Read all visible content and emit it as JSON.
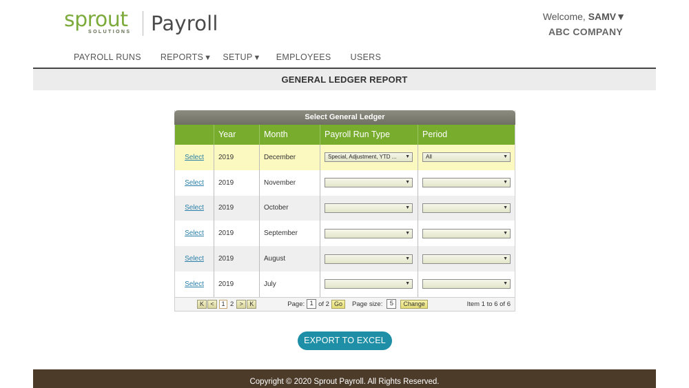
{
  "header": {
    "logo_word": "sprout",
    "logo_sub": "SOLUTIONS",
    "product": "Payroll",
    "welcome_prefix": "Welcome, ",
    "user": "SAMV",
    "company": "ABC COMPANY"
  },
  "nav": {
    "payroll_runs": "PAYROLL RUNS",
    "reports": "REPORTS",
    "setup": "SETUP",
    "employees": "EMPLOYEES",
    "users": "USERS"
  },
  "page_title": "GENERAL LEDGER REPORT",
  "grid": {
    "caption": "Select General Ledger",
    "columns": [
      "",
      "Year",
      "Month",
      "Payroll Run Type",
      "Period"
    ],
    "rows": [
      {
        "action": "Select",
        "year": "2019",
        "month": "December",
        "run_type": "Special, Adjustment, YTD ...",
        "period": "All"
      },
      {
        "action": "Select",
        "year": "2019",
        "month": "November",
        "run_type": "",
        "period": ""
      },
      {
        "action": "Select",
        "year": "2019",
        "month": "October",
        "run_type": "",
        "period": ""
      },
      {
        "action": "Select",
        "year": "2019",
        "month": "September",
        "run_type": "",
        "period": ""
      },
      {
        "action": "Select",
        "year": "2019",
        "month": "August",
        "run_type": "",
        "period": ""
      },
      {
        "action": "Select",
        "year": "2019",
        "month": "July",
        "run_type": "",
        "period": ""
      }
    ]
  },
  "pager": {
    "first": "K",
    "prev": "<",
    "page1": "1",
    "page2": "2",
    "next": ">",
    "last": "K",
    "page_label": "Page:",
    "page_value": "1",
    "of_label": "of 2",
    "go": "Go",
    "size_label": "Page size:",
    "size_value": "5",
    "change": "Change",
    "items": "Item 1 to 6 of 6"
  },
  "export_label": "EXPORT TO EXCEL",
  "footer": "Copyright © 2020 Sprout Payroll. All Rights Reserved.",
  "colors": {
    "brand_green": "#7cab3c",
    "grid_header": "#77ac2c",
    "export_button": "#1e8fa6",
    "footer_bg": "#4d3b2a",
    "selected_row": "#fcf9c0"
  }
}
